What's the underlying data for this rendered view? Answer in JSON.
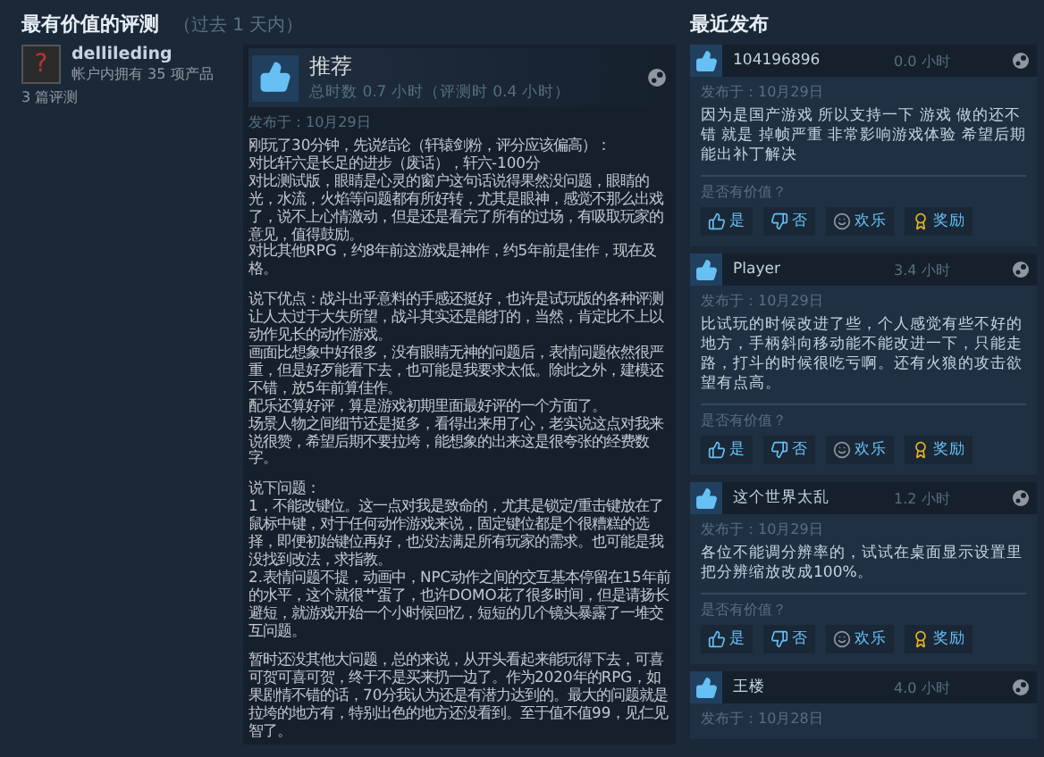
{
  "section_title": "最有价值的评测",
  "section_subtitle": "（过去 1 天内）",
  "reviewer": {
    "avatar": "?",
    "name": "dellileding",
    "products": "帐户内拥有 35 项产品",
    "reviews": "3 篇评测"
  },
  "review": {
    "verdict": "推荐",
    "recommended": true,
    "hours": "总时数 0.7 小时（评测时 0.4 小时）",
    "date": "发布于：10月29日",
    "sections": [
      [
        "刚玩了30分钟，先说结论（轩辕剑粉，评分应该偏高）：",
        "对比轩六是长足的进步（废话），轩六-100分",
        "对比测试版，眼睛是心灵的窗户这句话说得果然没问题，眼睛的光，水流，火焰等问题都有所好转，尤其是眼神，感觉不那么出戏了，说不上心情激动，但是还是看完了所有的过场，有吸取玩家的意见，值得鼓励。",
        "对比其他RPG，约8年前这游戏是神作，约5年前是佳作，现在及格。"
      ],
      [
        "说下优点：战斗出乎意料的手感还挺好，也许是试玩版的各种评测让人太过于大失所望，战斗其实还是能打的，当然，肯定比不上以动作见长的动作游戏。",
        "画面比想象中好很多，没有眼睛无神的问题后，表情问题依然很严重，但是好歹能看下去，也可能是我要求太低。除此之外，建模还不错，放5年前算佳作。",
        "配乐还算好评，算是游戏初期里面最好评的一个方面了。",
        "场景人物之间细节还是挺多，看得出来用了心，老实说这点对我来说很赞，希望后期不要拉垮，能想象的出来这是很夸张的经费数字。"
      ],
      [
        "说下问题：",
        "1，不能改键位。这一点对我是致命的，尤其是锁定/重击键放在了鼠标中键，对于任何动作游戏来说，固定键位都是个很糟糕的选择，即便初始键位再好，也没法满足所有玩家的需求。也可能是我没找到改法，求指教。",
        "2.表情问题不提，动画中，NPC动作之间的交互基本停留在15年前的水平，这个就很艹蛋了，也许DOMO花了很多时间，但是请扬长避短，就游戏开始一个小时候回忆，短短的几个镜头暴露了一堆交互问题。"
      ],
      [
        "暂时还没其他大问题，总的来说，从开头看起来能玩得下去，可喜可贺可喜可贺，终于不是买来扔一边了。作为2020年的RPG，如果剧情不错的话，70分我认为还是有潜力达到的。最大的问题就是拉垮的地方有，特别出色的地方还没看到。至于值不值99，见仁见智了。"
      ]
    ]
  },
  "recent": {
    "title": "最近发布",
    "items": [
      {
        "user": "104196896",
        "recommended": true,
        "hours": "0.0 小时",
        "date": "发布于：10月29日",
        "text": "因为是国产游戏 所以支持一下 游戏 做的还不错 就是 掉帧严重 非常影响游戏体验 希望后期能出补丁解决",
        "question": "是否有价值？",
        "buttons": [
          {
            "kind": "yes",
            "label": "是"
          },
          {
            "kind": "no",
            "label": "否"
          },
          {
            "kind": "funny",
            "label": "欢乐"
          },
          {
            "kind": "award",
            "label": "奖励"
          }
        ]
      },
      {
        "user": "Player",
        "recommended": true,
        "hours": "3.4 小时",
        "date": "发布于：10月29日",
        "text": "比试玩的时候改进了些，个人感觉有些不好的地方，手柄斜向移动能不能改进一下，只能走路，打斗的时候很吃亏啊。还有火狼的攻击欲望有点高。",
        "question": "是否有价值？",
        "buttons": [
          {
            "kind": "yes",
            "label": "是"
          },
          {
            "kind": "no",
            "label": "否"
          },
          {
            "kind": "funny",
            "label": "欢乐"
          },
          {
            "kind": "award",
            "label": "奖励"
          }
        ]
      },
      {
        "user": "这个世界太乱",
        "recommended": true,
        "hours": "1.2 小时",
        "date": "发布于：10月29日",
        "text": "各位不能调分辨率的，试试在桌面显示设置里把分辨缩放改成100%。",
        "question": "是否有价值？",
        "buttons": [
          {
            "kind": "yes",
            "label": "是"
          },
          {
            "kind": "no",
            "label": "否"
          },
          {
            "kind": "funny",
            "label": "欢乐"
          },
          {
            "kind": "award",
            "label": "奖励"
          }
        ]
      },
      {
        "user": "王楼",
        "recommended": true,
        "hours": "4.0 小时",
        "date": "发布于：10月28日"
      }
    ]
  }
}
